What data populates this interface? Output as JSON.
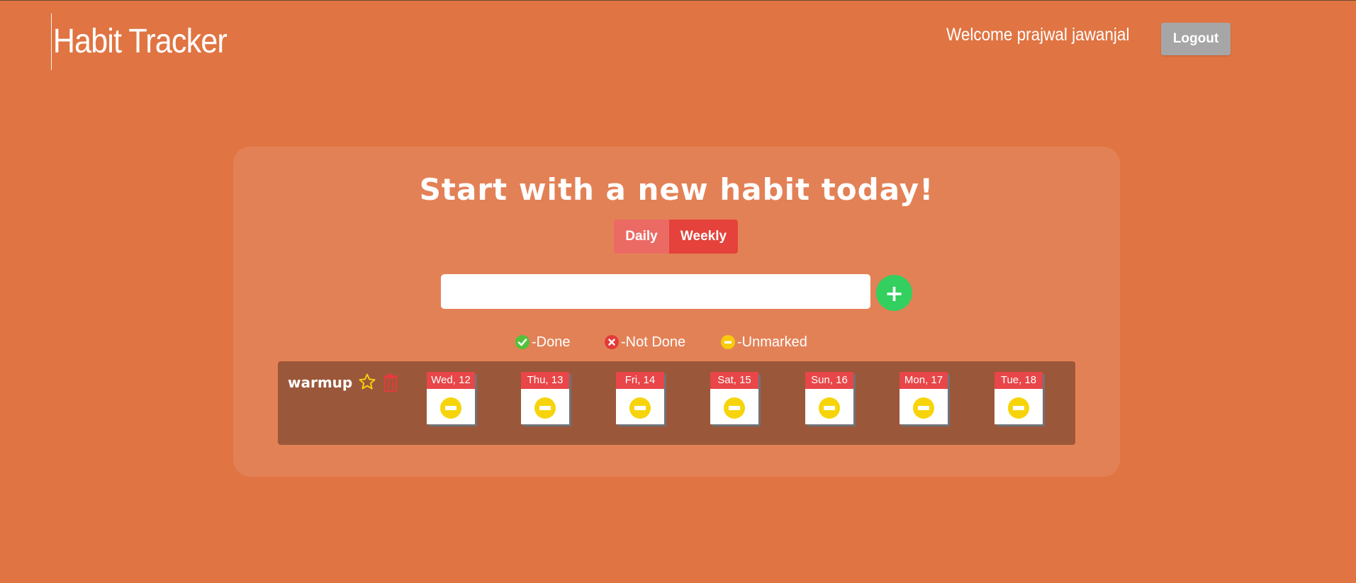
{
  "app": {
    "title": "Habit Tracker",
    "welcome": "Welcome prajwal jawanjal",
    "logout_label": "Logout"
  },
  "main": {
    "heading": "Start with a new habit today!",
    "toggle": {
      "daily_label": "Daily",
      "weekly_label": "Weekly",
      "selected": "Weekly"
    },
    "habit_input": {
      "value": "",
      "placeholder": ""
    },
    "add_button_label": "+",
    "legend": {
      "done": "-Done",
      "not_done": "-Not Done",
      "unmarked": "-Unmarked"
    }
  },
  "habits": [
    {
      "name": "warmup",
      "days": [
        {
          "label": "Wed, 12",
          "status": "unmarked"
        },
        {
          "label": "Thu, 13",
          "status": "unmarked"
        },
        {
          "label": "Fri, 14",
          "status": "unmarked"
        },
        {
          "label": "Sat, 15",
          "status": "unmarked"
        },
        {
          "label": "Sun, 16",
          "status": "unmarked"
        },
        {
          "label": "Mon, 17",
          "status": "unmarked"
        },
        {
          "label": "Tue, 18",
          "status": "unmarked"
        }
      ]
    }
  ],
  "icons": {
    "favorite": "star-icon",
    "delete": "trash-icon",
    "done": "check-circle-icon",
    "not_done": "x-circle-icon",
    "unmarked": "minus-circle-icon",
    "add": "plus-icon"
  },
  "colors": {
    "background": "#e07442",
    "card": "#e38156",
    "habit_row": "#9b573a",
    "done": "#52c23b",
    "not_done": "#e43a3a",
    "unmarked": "#f7cb0d",
    "weekly_active": "#e4423b",
    "daily": "#ec6a64",
    "add_button": "#33cf5f",
    "logout_button": "#a6a6a6"
  }
}
